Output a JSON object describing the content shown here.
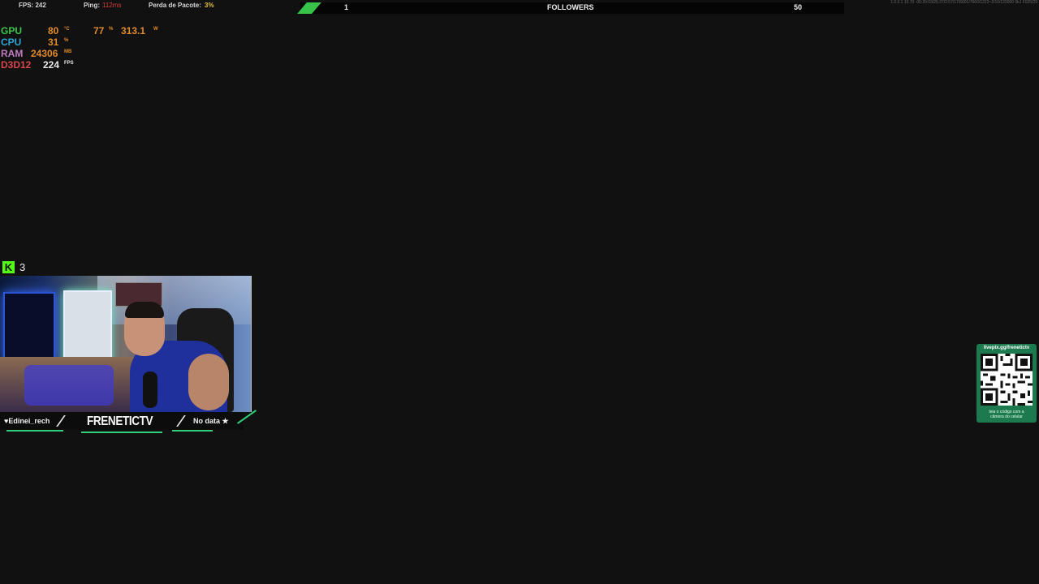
{
  "net": {
    "fps_label": "FPS: 242",
    "ping_label": "Ping:",
    "ping_value": "112ms",
    "loss_label": "Perda de Pacote:",
    "loss_value": "3%"
  },
  "hw_monitor": {
    "gpu": {
      "label": "GPU",
      "temp": "80",
      "temp_unit": "°C",
      "load": "77",
      "load_unit": "%",
      "power": "313.1",
      "power_unit": "W"
    },
    "cpu": {
      "label": "CPU",
      "load": "31",
      "load_unit": "%"
    },
    "ram": {
      "label": "RAM",
      "value": "24306",
      "unit": "MB"
    },
    "api": {
      "label": "D3D12",
      "fps": "224",
      "unit": "FPS"
    }
  },
  "follower_goal": {
    "current": "1",
    "label": "FOLLOWERS",
    "target": "50",
    "progress": 0.02,
    "accent": "#37c24a"
  },
  "top_right_text": "1.0.0.1 10.70 -00:20:03/25:27/2:57/17/6001/7660/1223~2/10/120000 0kJ F025/29",
  "kick": {
    "icon": "kick-logo-icon",
    "viewers": "3",
    "color": "#53fc18"
  },
  "cam_strip": {
    "chat_user": "♥Edinei_rech",
    "brand": "FRENETICTV",
    "status": "No data ★",
    "accent": "#2fd07a"
  },
  "qr_widget": {
    "url": "livepix.gg/frenetictv",
    "caption_line1": "leia o código com a",
    "caption_line2": "câmera do celular",
    "bg": "#1d7a4e"
  }
}
